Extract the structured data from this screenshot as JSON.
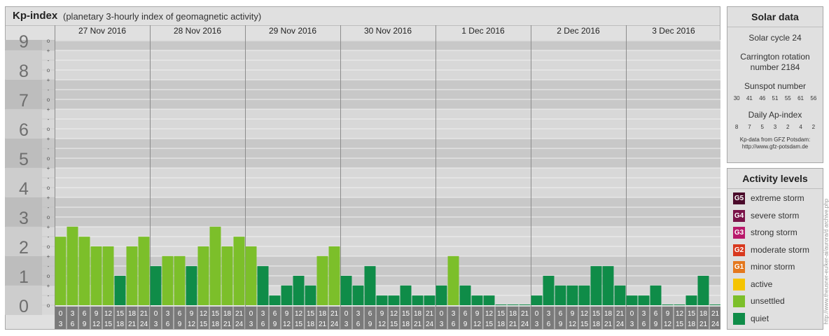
{
  "header": {
    "title": "Kp-index",
    "subtitle": "(planetary 3-hourly index of geomagnetic activity)"
  },
  "solar": {
    "title": "Solar data",
    "cycle": "Solar cycle 24",
    "carrington_line1": "Carrington rotation",
    "carrington_line2": "number 2184",
    "sunspot_label": "Sunspot number",
    "sunspot_values": [
      "30",
      "41",
      "46",
      "51",
      "55",
      "61",
      "56"
    ],
    "ap_label": "Daily Ap-index",
    "ap_values": [
      "8",
      "7",
      "5",
      "3",
      "2",
      "4",
      "2"
    ],
    "source_line1": "Kp-data from GFZ Potsdam:",
    "source_line2": "http://www.gfz-potsdam.de"
  },
  "levels": {
    "title": "Activity levels",
    "items": [
      {
        "code": "G5",
        "label": "extreme storm",
        "color": "#4a0a2a"
      },
      {
        "code": "G4",
        "label": "severe storm",
        "color": "#7a1248"
      },
      {
        "code": "G3",
        "label": "strong storm",
        "color": "#b8186a"
      },
      {
        "code": "G2",
        "label": "moderate storm",
        "color": "#d8381e"
      },
      {
        "code": "G1",
        "label": "minor storm",
        "color": "#e4781e"
      },
      {
        "code": "",
        "label": "active",
        "color": "#f5c400"
      },
      {
        "code": "",
        "label": "unsettled",
        "color": "#7cbf2a"
      },
      {
        "code": "",
        "label": "quiet",
        "color": "#0f8c48"
      }
    ]
  },
  "watermark": "http://www.theusner-eu/ker-ai/aurora/d archive.php",
  "chart_data": {
    "type": "bar",
    "title": "Kp-index",
    "ylim": [
      0,
      9
    ],
    "y_ticks": [
      "0",
      "1",
      "2",
      "3",
      "4",
      "5",
      "6",
      "7",
      "8",
      "9"
    ],
    "minor_ticks": [
      "o",
      "-",
      "+"
    ],
    "days": [
      "27 Nov 2016",
      "28 Nov 2016",
      "29 Nov 2016",
      "30 Nov 2016",
      "1 Dec 2016",
      "2 Dec 2016",
      "3 Dec 2016"
    ],
    "hour_labels_start": [
      "0",
      "3",
      "6",
      "9",
      "12",
      "15",
      "18",
      "21"
    ],
    "hour_labels_end": [
      "3",
      "6",
      "9",
      "12",
      "15",
      "18",
      "21",
      "24"
    ],
    "series": [
      {
        "values": [
          [
            2.33,
            2.67,
            2.33,
            2.0,
            2.0,
            1.0,
            2.0,
            2.33
          ],
          [
            1.33,
            1.67,
            1.67,
            1.33,
            2.0,
            2.67,
            2.0,
            2.33
          ],
          [
            2.0,
            1.33,
            0.33,
            0.67,
            1.0,
            0.67,
            1.67,
            2.0
          ],
          [
            1.0,
            0.67,
            1.33,
            0.33,
            0.33,
            0.67,
            0.33,
            0.33
          ],
          [
            0.67,
            1.67,
            0.67,
            0.33,
            0.33,
            0.0,
            0.0,
            0.0
          ],
          [
            0.33,
            1.0,
            0.67,
            0.67,
            0.67,
            1.33,
            1.33,
            0.67
          ],
          [
            0.33,
            0.33,
            0.67,
            0.0,
            0.0,
            0.33,
            1.0,
            0.0
          ]
        ]
      }
    ],
    "color_quiet": "#0f8c48",
    "color_unsettled": "#7cbf2a"
  }
}
